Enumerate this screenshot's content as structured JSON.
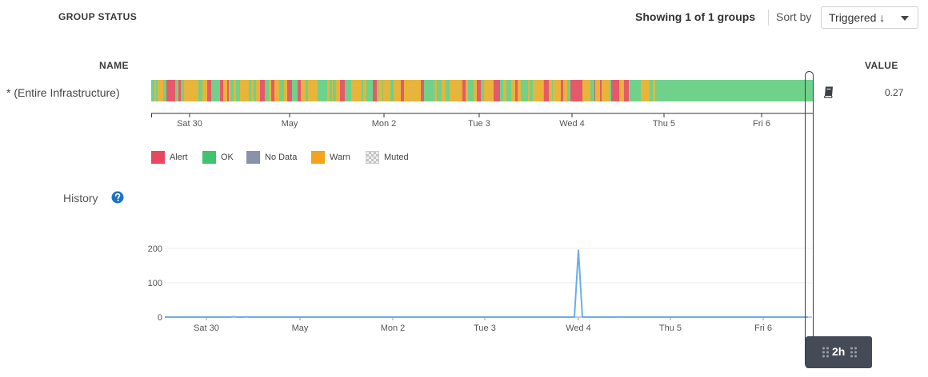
{
  "header": {
    "title": "GROUP STATUS",
    "showing": "Showing 1 of 1 groups",
    "sort_label": "Sort by",
    "sort_value": "Triggered ↓"
  },
  "table": {
    "name_header": "NAME",
    "value_header": "VALUE",
    "rows": [
      {
        "name": "* (Entire Infrastructure)",
        "value": "0.27"
      }
    ]
  },
  "timeline_ticks": [
    "Sat 30",
    "May",
    "Mon 2",
    "Tue 3",
    "Wed 4",
    "Thu 5",
    "Fri 6"
  ],
  "legend": [
    {
      "label": "Alert",
      "color": "#e8475d"
    },
    {
      "label": "OK",
      "color": "#3ec46d"
    },
    {
      "label": "No Data",
      "color": "#8a91a8"
    },
    {
      "label": "Warn",
      "color": "#f5a31a"
    },
    {
      "label": "Muted",
      "color": "hatched"
    }
  ],
  "status_colors": {
    "alert": "#e55a6a",
    "ok": "#6fd18a",
    "warn": "#e9b43a"
  },
  "history": {
    "label": "History",
    "help_icon": "question-circle-icon"
  },
  "brush": {
    "label": "2h"
  },
  "chart_data": {
    "type": "line",
    "x": [
      "Sat 30",
      "May",
      "Mon 2",
      "Tue 3",
      "Wed 4",
      "Thu 5",
      "Fri 6"
    ],
    "series": [
      {
        "values": [
          0,
          0,
          0,
          0,
          0,
          0,
          0
        ],
        "spike": {
          "at": "Wed 4",
          "peak": 195
        }
      }
    ],
    "yticks": [
      0,
      100,
      200
    ],
    "ylim": [
      0,
      200
    ],
    "grid": true,
    "line_color": "#6aaee8"
  }
}
